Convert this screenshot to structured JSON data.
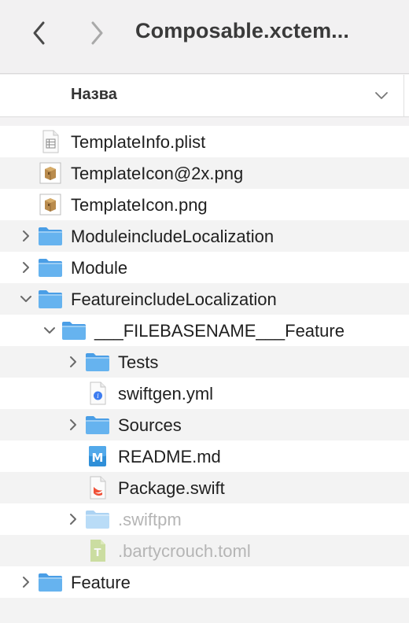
{
  "toolbar": {
    "title": "Composable.xctem...",
    "back_icon": "chevron-left-icon",
    "forward_icon": "chevron-right-icon"
  },
  "column_header": {
    "name_label": "Назва",
    "sort_icon": "chevron-down-icon"
  },
  "colors": {
    "folder": "#5aa9e8",
    "folder_light": "#8cc8f4",
    "row_alt": "#f3f3f3",
    "text_dimmed": "#b5b5b5"
  },
  "files": [
    {
      "name": "TemplateInfo.plist",
      "icon": "plist-file-icon",
      "depth": 0,
      "expandable": false,
      "expanded": false,
      "dimmed": false
    },
    {
      "name": "TemplateIcon@2x.png",
      "icon": "image-file-icon",
      "depth": 0,
      "expandable": false,
      "expanded": false,
      "dimmed": false
    },
    {
      "name": "TemplateIcon.png",
      "icon": "image-file-icon",
      "depth": 0,
      "expandable": false,
      "expanded": false,
      "dimmed": false
    },
    {
      "name": "ModuleincludeLocalization",
      "icon": "folder-icon",
      "depth": 0,
      "expandable": true,
      "expanded": false,
      "dimmed": false
    },
    {
      "name": "Module",
      "icon": "folder-icon",
      "depth": 0,
      "expandable": true,
      "expanded": false,
      "dimmed": false
    },
    {
      "name": "FeatureincludeLocalization",
      "icon": "folder-icon",
      "depth": 0,
      "expandable": true,
      "expanded": true,
      "dimmed": false
    },
    {
      "name": "___FILEBASENAME___Feature",
      "icon": "folder-icon",
      "depth": 1,
      "expandable": true,
      "expanded": true,
      "dimmed": false
    },
    {
      "name": "Tests",
      "icon": "folder-icon",
      "depth": 2,
      "expandable": true,
      "expanded": false,
      "dimmed": false
    },
    {
      "name": "swiftgen.yml",
      "icon": "yml-file-icon",
      "depth": 2,
      "expandable": false,
      "expanded": false,
      "dimmed": false
    },
    {
      "name": "Sources",
      "icon": "folder-icon",
      "depth": 2,
      "expandable": true,
      "expanded": false,
      "dimmed": false
    },
    {
      "name": "README.md",
      "icon": "markdown-file-icon",
      "depth": 2,
      "expandable": false,
      "expanded": false,
      "dimmed": false
    },
    {
      "name": "Package.swift",
      "icon": "swift-file-icon",
      "depth": 2,
      "expandable": false,
      "expanded": false,
      "dimmed": false
    },
    {
      "name": ".swiftpm",
      "icon": "folder-icon",
      "depth": 2,
      "expandable": true,
      "expanded": false,
      "dimmed": true
    },
    {
      "name": ".bartycrouch.toml",
      "icon": "toml-file-icon",
      "depth": 2,
      "expandable": false,
      "expanded": false,
      "dimmed": true
    },
    {
      "name": "Feature",
      "icon": "folder-icon",
      "depth": 0,
      "expandable": true,
      "expanded": false,
      "dimmed": false
    }
  ]
}
